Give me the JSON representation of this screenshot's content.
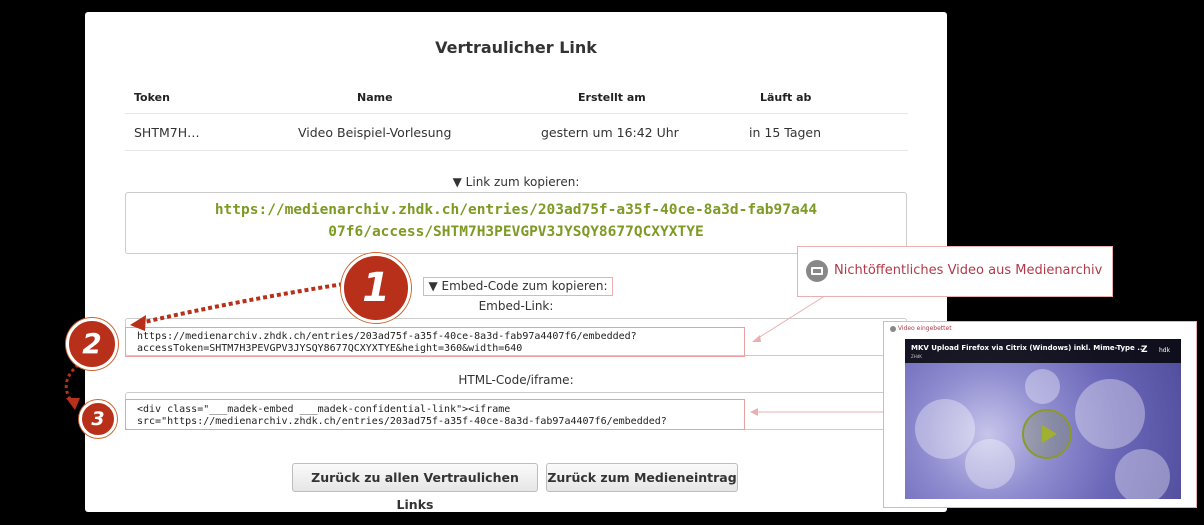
{
  "dialog": {
    "title": "Vertraulicher Link",
    "columns": [
      "Token",
      "Name",
      "Erstellt am",
      "Läuft ab"
    ],
    "row": {
      "token": "SHTM7H…",
      "name": "Video Beispiel-Vorlesung",
      "created": "gestern um 16:42 Uhr",
      "expires": "in 15 Tagen"
    },
    "link_label": "▼ Link zum kopieren:",
    "link_line1": "https://medienarchiv.zhdk.ch/entries/203ad75f-a35f-40ce-8a3d-fab97a44",
    "link_line2": "07f6/access/SHTM7H3PEVGPV3JYSQY8677QCXYXTYE",
    "embed_label": "▼ Embed-Code zum kopieren:",
    "embed_link_label": "Embed-Link:",
    "embed_link_line1": "https://medienarchiv.zhdk.ch/entries/203ad75f-a35f-40ce-8a3d-fab97a4407f6/embedded?",
    "embed_link_line2": "accessToken=SHTM7H3PEVGPV3JYSQY8677QCXYXTYE&height=360&width=640",
    "iframe_label": "HTML-Code/iframe:",
    "iframe_line1": "<div class=\"___madek-embed ___madek-confidential-link\"><iframe",
    "iframe_line2": "src=\"https://medienarchiv.zhdk.ch/entries/203ad75f-a35f-40ce-8a3d-fab97a4407f6/embedded?",
    "button_back_links": "Zurück zu allen Vertraulichen Links",
    "button_back_entry": "Zurück zum Medieneintrag"
  },
  "annotations": {
    "badges": [
      "1",
      "2",
      "3"
    ],
    "callout_text": "Nichtöffentliches Video aus Medienarchiv",
    "accent_color": "#b8301a"
  },
  "preview": {
    "header": "Video eingebettet",
    "video_title": "MKV Upload Firefox via Citrix (Windows) inkl. Mime-Type ...",
    "video_sub": "ZHdK",
    "logo_letter": "Z",
    "logo_text": "hdk"
  }
}
